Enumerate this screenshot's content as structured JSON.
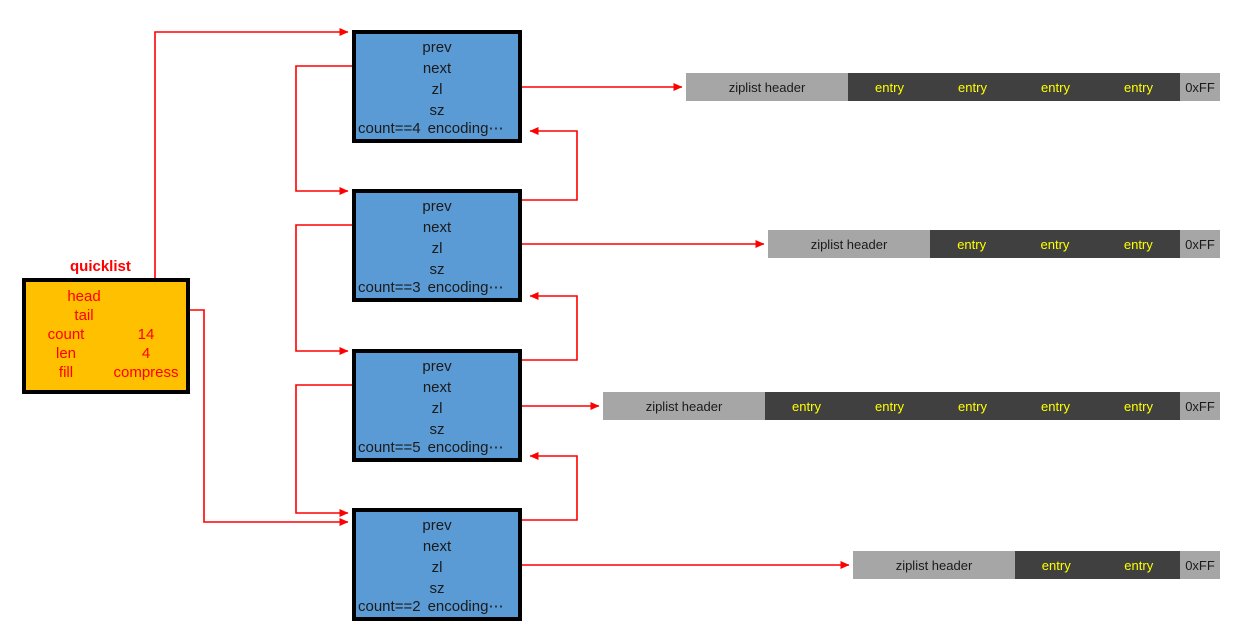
{
  "colors": {
    "wire": "#ff0000",
    "quicklist_fill": "#ffc000",
    "quicklist_text": "#ff0000",
    "node_fill": "#5b9bd5",
    "node_text": "#1a1a1a",
    "ziplist_header_fill": "#a6a6a6",
    "ziplist_entry_fill": "#404040",
    "ziplist_entry_text": "#ffff00",
    "border": "#000000",
    "background": "#ffffff"
  },
  "quicklist": {
    "title": "quicklist",
    "rows": [
      {
        "kind": "single",
        "label": "head"
      },
      {
        "kind": "single",
        "label": "tail"
      },
      {
        "kind": "pair",
        "label": "count",
        "value": "14"
      },
      {
        "kind": "pair",
        "label": "len",
        "value": "4"
      },
      {
        "kind": "pair",
        "label": "fill",
        "value": "compress"
      }
    ]
  },
  "nodes": [
    {
      "fields": [
        "prev",
        "next",
        "zl",
        "sz"
      ],
      "count_label": "count==4",
      "encoding_label": "encoding⋯"
    },
    {
      "fields": [
        "prev",
        "next",
        "zl",
        "sz"
      ],
      "count_label": "count==3",
      "encoding_label": "encoding⋯"
    },
    {
      "fields": [
        "prev",
        "next",
        "zl",
        "sz"
      ],
      "count_label": "count==5",
      "encoding_label": "encoding⋯"
    },
    {
      "fields": [
        "prev",
        "next",
        "zl",
        "sz"
      ],
      "count_label": "count==2",
      "encoding_label": "encoding⋯"
    }
  ],
  "ziplists": [
    {
      "header_label": "ziplist header",
      "entry_label": "entry",
      "entry_count": 4,
      "end_label": "0xFF"
    },
    {
      "header_label": "ziplist header",
      "entry_label": "entry",
      "entry_count": 3,
      "end_label": "0xFF"
    },
    {
      "header_label": "ziplist header",
      "entry_label": "entry",
      "entry_count": 5,
      "end_label": "0xFF"
    },
    {
      "header_label": "ziplist header",
      "entry_label": "entry",
      "entry_count": 2,
      "end_label": "0xFF"
    }
  ]
}
